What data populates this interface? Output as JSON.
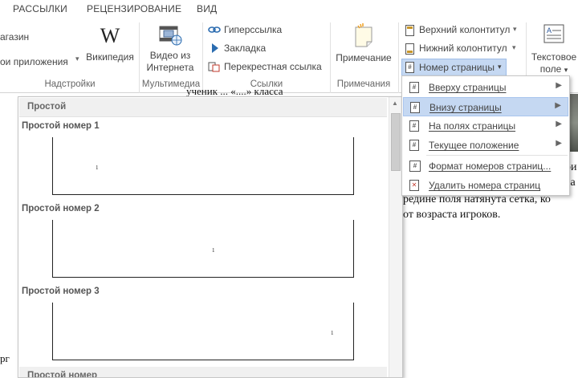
{
  "tabs": [
    "РАССЫЛКИ",
    "РЕЦЕНЗИРОВАНИЕ",
    "ВИД"
  ],
  "ribbon": {
    "addins": {
      "store_partial": "агазин",
      "my_apps_partial": "ои приложения",
      "wikipedia": "Википедия",
      "group": "Надстройки"
    },
    "media": {
      "online_video_line1": "Видео из",
      "online_video_line2": "Интернета",
      "group": "Мультимедиа"
    },
    "links": {
      "hyperlink": "Гиперссылка",
      "bookmark": "Закладка",
      "cross_reference": "Перекрестная ссылка",
      "group": "Ссылки"
    },
    "comments": {
      "comment": "Примечание",
      "group": "Примечания"
    },
    "header_footer": {
      "header": "Верхний колонтитул",
      "footer": "Нижний колонтитул",
      "page_number": "Номер страницы"
    },
    "text": {
      "textbox_line1": "Текстовое",
      "textbox_line2": "поле"
    }
  },
  "document": {
    "line_top": "ученик ... «....» класса",
    "line1": "ои",
    "line2": "за",
    "line3": "редине поля натянута сетка, ко",
    "line4": "от возраста игроков.",
    "left_fragment": "рг"
  },
  "gallery": {
    "section1": "Простой",
    "items": [
      {
        "label": "Простой номер 1",
        "num": "1"
      },
      {
        "label": "Простой номер 2",
        "num": "1"
      },
      {
        "label": "Простой номер 3",
        "num": "1"
      }
    ],
    "section2": "Простой номер"
  },
  "menu": {
    "items": [
      {
        "label": "Вверху страницы",
        "icon": "page-top-icon",
        "submenu": true
      },
      {
        "label": "Внизу страницы",
        "icon": "page-bottom-icon",
        "submenu": true,
        "highlighted": true
      },
      {
        "label": "На полях страницы",
        "icon": "page-margin-icon",
        "submenu": true
      },
      {
        "label": "Текущее положение",
        "icon": "current-position-icon",
        "submenu": true
      },
      {
        "label": "Формат номеров страниц...",
        "icon": "format-numbers-icon",
        "submenu": false
      },
      {
        "label": "Удалить номера страниц",
        "icon": "remove-numbers-icon",
        "submenu": false
      }
    ]
  },
  "colors": {
    "highlight": "#c5d8f2",
    "accent_blue": "#2b579a"
  }
}
